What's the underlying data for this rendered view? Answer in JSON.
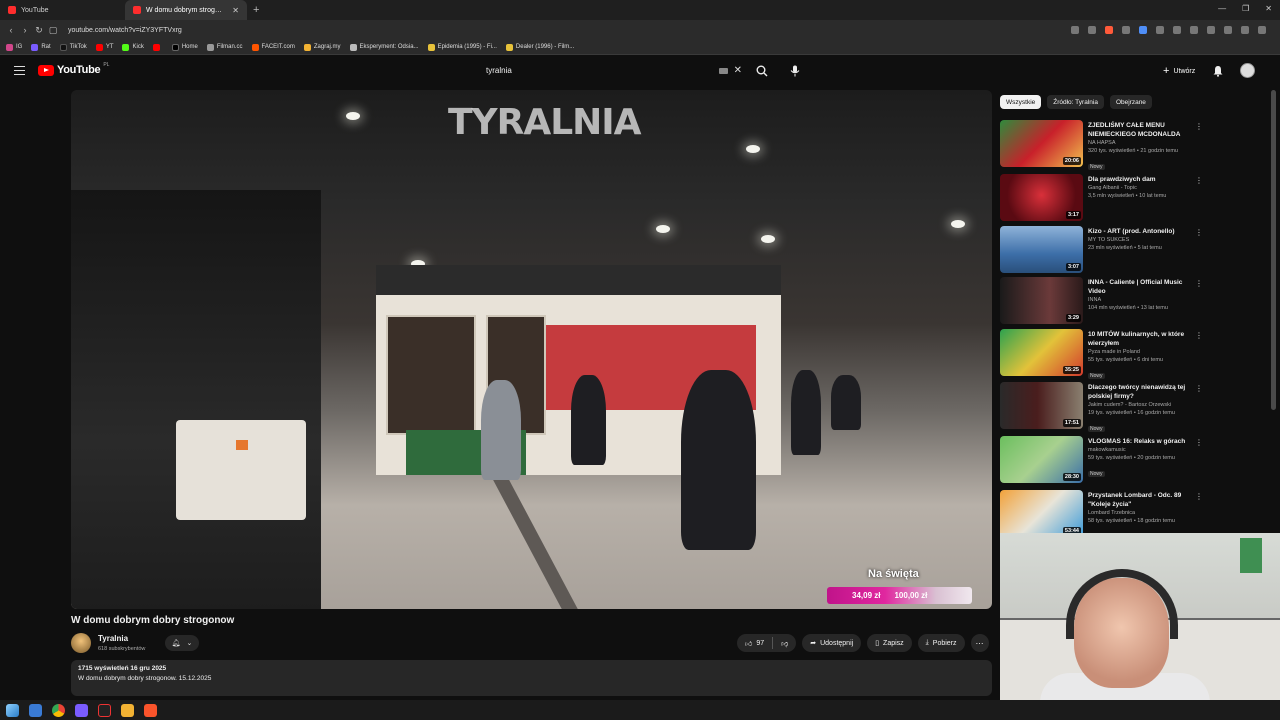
{
  "browser": {
    "tabs": [
      {
        "label": "YouTube",
        "active": false
      },
      {
        "label": "W domu dobrym strog…",
        "active": true
      }
    ],
    "url": "youtube.com/watch?v=iZY3YFTVxrg",
    "bookmarks": [
      "IG",
      "Rat",
      "TikTok",
      "YT",
      "Kick",
      "",
      "Home",
      "Filman.cc",
      "FACEIT.com",
      "Zagraj.my",
      "Eksperyment: Odsia...",
      "Epidemia (1995) - Fi...",
      "Dealer (1996) - Film..."
    ]
  },
  "header": {
    "logo_text": "YouTube",
    "country": "PL",
    "search_query": "tyralnia",
    "create_label": "Utwórz"
  },
  "video": {
    "watermark": "TYRALNIA",
    "overlay_label": "Na święta",
    "current_amount": "34,09 zł",
    "target_amount": "100,00 zł",
    "progress": 0.34,
    "title": "W domu dobrym dobry strogonow",
    "channel": {
      "name": "Tyralnia",
      "subs": "618 subskrybentów"
    },
    "actions": {
      "likes": "97",
      "share": "Udostępnij",
      "save": "Zapisz",
      "download": "Pobierz"
    },
    "description": {
      "meta": "1715 wyświetleń  16 gru 2025",
      "text": "W domu dobrym dobry strogonow. 15.12.2025"
    }
  },
  "sidebar": {
    "chips": [
      "Wszystkie",
      "Źródło: Tyralnia",
      "Obejrzane"
    ],
    "items": [
      {
        "title": "ZJEDLIŚMY CAŁE MENU NIEMIECKIEGO MCDONALDA",
        "channel": "NA HAPSA",
        "views": "320 tys. wyświetleń • 21 godzin temu",
        "badge": "Nowy",
        "duration": "20:06"
      },
      {
        "title": "Dla prawdziwych dam",
        "channel": "Gang Albanii - Topic",
        "views": "3,5 mln wyświetleń • 10 lat temu",
        "badge": "",
        "duration": "3:17"
      },
      {
        "title": "Kizo - ART (prod. Antonello)",
        "channel": "MY TO SUKCES",
        "views": "23 mln wyświetleń • 5 lat temu",
        "badge": "",
        "duration": "3:07"
      },
      {
        "title": "INNA - Caliente | Official Music Video",
        "channel": "INNA",
        "views": "104 mln wyświetleń • 13 lat temu",
        "badge": "",
        "duration": "3:29"
      },
      {
        "title": "10 MITÓW kulinarnych, w które wierzyłem",
        "channel": "Pyza made in Poland",
        "views": "55 tys. wyświetleń • 6 dni temu",
        "badge": "Nowy",
        "duration": "35:25"
      },
      {
        "title": "Dlaczego twórcy nienawidzą tej polskiej firmy?",
        "channel": "Jakim cudem? - Bartosz Orzewski",
        "views": "19 tys. wyświetleń • 16 godzin temu",
        "badge": "Nowy",
        "duration": "17:51"
      },
      {
        "title": "VLOGMAS 16: Relaks w górach",
        "channel": "makowkamusic",
        "views": "59 tys. wyświetleń • 20 godzin temu",
        "badge": "Nowy",
        "duration": "28:30"
      },
      {
        "title": "Przystanek Lombard - Odc. 89 \"Koleje życia\"",
        "channel": "Lombard Trzebnica",
        "views": "58 tys. wyświetleń • 18 godzin temu",
        "badge": "",
        "duration": "53:44"
      }
    ]
  },
  "colors": {
    "background": "#0f0f0f",
    "accent_red": "#ff0000",
    "donation_pink": "#e0279f"
  }
}
